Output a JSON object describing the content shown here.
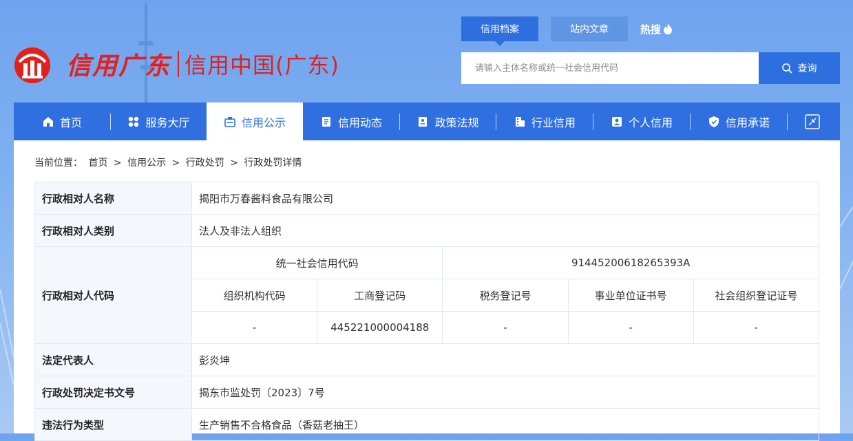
{
  "header": {
    "logo_script": "信用广东",
    "logo_text": "信用中国(广东)",
    "top_tabs": [
      "信用档案",
      "站内文章"
    ],
    "hot_search": "热搜",
    "search_placeholder": "请输入主体名称或统一社会信用代码",
    "search_button": "查询"
  },
  "nav": {
    "items": [
      {
        "label": "首页",
        "icon": "home-icon"
      },
      {
        "label": "服务大厅",
        "icon": "grid-icon"
      },
      {
        "label": "信用公示",
        "icon": "announce-icon"
      },
      {
        "label": "信用动态",
        "icon": "news-icon"
      },
      {
        "label": "政策法规",
        "icon": "document-icon"
      },
      {
        "label": "行业信用",
        "icon": "building-icon"
      },
      {
        "label": "个人信用",
        "icon": "person-card-icon"
      },
      {
        "label": "信用承诺",
        "icon": "shield-check-icon"
      }
    ],
    "active_index": 2,
    "expand_icon": "expand-icon"
  },
  "breadcrumb": {
    "prefix": "当前位置：",
    "items": [
      "首页",
      "信用公示",
      "行政处罚",
      "行政处罚详情"
    ],
    "separator": ">"
  },
  "detail": {
    "name_label": "行政相对人名称",
    "name_value": "揭阳市万春酱料食品有限公司",
    "type_label": "行政相对人类别",
    "type_value": "法人及非法人组织",
    "code_label": "行政相对人代码",
    "uscc_label": "统一社会信用代码",
    "uscc_value": "91445200618265393A",
    "sub_headers": [
      "组织机构代码",
      "工商登记码",
      "税务登记号",
      "事业单位证书号",
      "社会组织登记证号"
    ],
    "sub_values": [
      "-",
      "445221000004188",
      "-",
      "-",
      "-"
    ],
    "rep_label": "法定代表人",
    "rep_value": "彭炎坤",
    "doc_label": "行政处罚决定书文号",
    "doc_value": "揭东市监处罚〔2023〕7号",
    "violation_label": "违法行为类型",
    "violation_value": "生产销售不合格食品（香菇老抽王）"
  },
  "colors": {
    "primary": "#2f6fe0",
    "logo_red": "#e3201b",
    "label_bg": "#f4f7fc"
  }
}
